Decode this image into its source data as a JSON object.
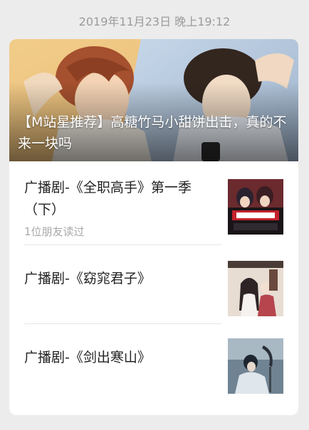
{
  "timestamp": "2019年11月23日 晚上19:12",
  "cover": {
    "title": "【M站星推荐】高糖竹马小甜饼出击，真的不来一块吗"
  },
  "articles": [
    {
      "title": "广播剧-《全职高手》第一季（下）",
      "meta": "1位朋友读过",
      "thumb_icon": "quanzhi-gaoshou-thumbnail"
    },
    {
      "title": "广播剧-《窈窕君子》",
      "meta": "",
      "thumb_icon": "yaotiao-junzi-thumbnail"
    },
    {
      "title": "广播剧-《剑出寒山》",
      "meta": "",
      "thumb_icon": "jianchu-hanshan-thumbnail"
    }
  ]
}
